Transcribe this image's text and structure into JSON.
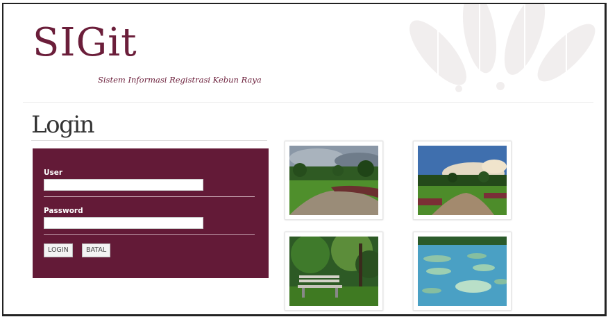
{
  "app": {
    "logo": "SIGit",
    "tagline": "Sistem Informasi Registrasi Kebun Raya"
  },
  "page": {
    "title": "Login"
  },
  "form": {
    "user_label": "User",
    "user_value": "",
    "password_label": "Password",
    "password_value": "",
    "login_button": "LOGIN",
    "cancel_button": "BATAL"
  },
  "gallery": [
    {
      "name": "garden-path-cloudy"
    },
    {
      "name": "garden-lawn-sunset"
    },
    {
      "name": "garden-bench"
    },
    {
      "name": "water-lilies-pond"
    }
  ],
  "colors": {
    "brand": "#6b1e3a",
    "panel": "#631a37"
  }
}
